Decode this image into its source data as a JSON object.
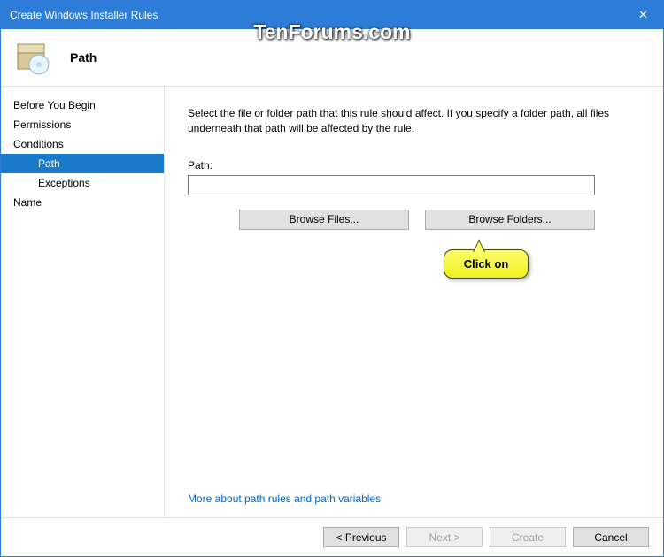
{
  "titlebar": {
    "title": "Create Windows Installer Rules",
    "close": "✕"
  },
  "watermark": "TenForums.com",
  "header": {
    "page_title": "Path"
  },
  "sidebar": {
    "items": [
      {
        "label": "Before You Begin",
        "indent": false,
        "selected": false
      },
      {
        "label": "Permissions",
        "indent": false,
        "selected": false
      },
      {
        "label": "Conditions",
        "indent": false,
        "selected": false
      },
      {
        "label": "Path",
        "indent": true,
        "selected": true
      },
      {
        "label": "Exceptions",
        "indent": true,
        "selected": false
      },
      {
        "label": "Name",
        "indent": false,
        "selected": false
      }
    ]
  },
  "content": {
    "instruction": "Select the file or folder path that this rule should affect. If you specify a folder path, all files underneath that path will be affected by the rule.",
    "path_label": "Path:",
    "path_value": "",
    "browse_files": "Browse Files...",
    "browse_folders": "Browse Folders...",
    "more_link": "More about path rules and path variables"
  },
  "footer": {
    "previous": "< Previous",
    "next": "Next >",
    "create": "Create",
    "cancel": "Cancel"
  },
  "callout": {
    "text": "Click on"
  }
}
